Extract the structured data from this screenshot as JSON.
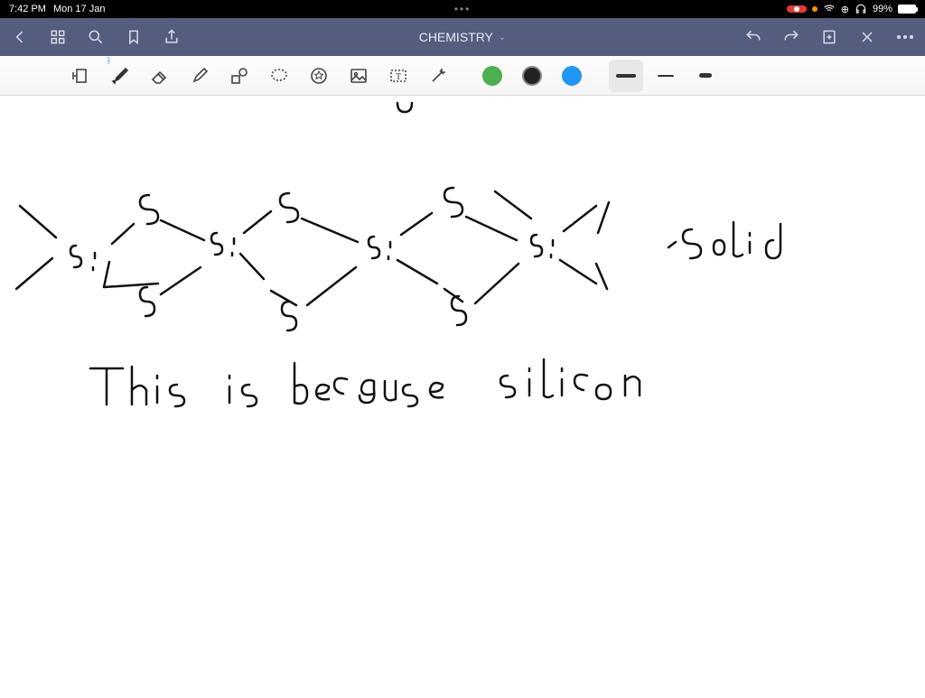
{
  "status": {
    "time": "7:42 PM",
    "date": "Mon 17 Jan",
    "dots": "•••",
    "battery_pct": "99%",
    "orange_dot": "#ff9500"
  },
  "nav": {
    "title": "CHEMISTRY"
  },
  "toolbar": {
    "tools": [
      "page-transition",
      "pen",
      "eraser",
      "highlighter",
      "shapes",
      "lasso",
      "stamp",
      "image",
      "text",
      "laser"
    ],
    "colors": {
      "green": "#4caf50",
      "black": "#222222",
      "blue": "#2196f3",
      "selected": "black"
    },
    "thickness_selected": "medium"
  },
  "handwriting": {
    "diagram_labels": [
      "Si",
      "S",
      "Si",
      "S",
      "Si",
      "S",
      "Si",
      "S",
      "S",
      "S",
      "Solid"
    ],
    "text_line": "This  is  because   silicon",
    "top_stray": "U"
  }
}
